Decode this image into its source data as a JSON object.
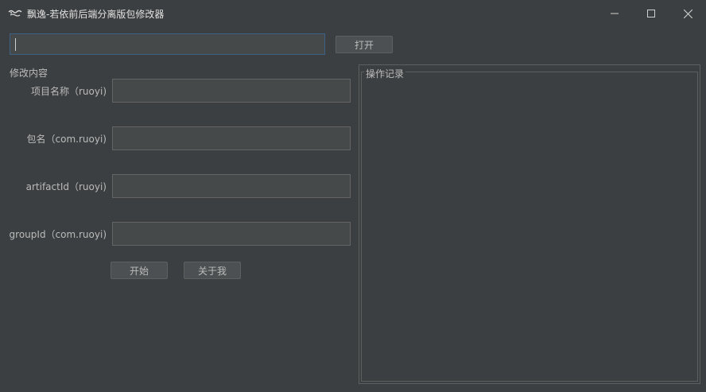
{
  "window": {
    "title": "飘逸-若依前后端分离版包修改器",
    "icon": "app-logo-icon",
    "controls": {
      "minimize": "minimize-icon",
      "maximize": "maximize-icon",
      "close": "close-icon"
    }
  },
  "path": {
    "value": "",
    "open_label": "打开"
  },
  "form": {
    "section_title": "修改内容",
    "fields": [
      {
        "label": "项目名称（ruoyi)",
        "value": ""
      },
      {
        "label": "包名（com.ruoyi)",
        "value": ""
      },
      {
        "label": "artifactId（ruoyi)",
        "value": ""
      },
      {
        "label": "groupId（com.ruoyi)",
        "value": ""
      }
    ],
    "start_label": "开始",
    "about_label": "关于我"
  },
  "log": {
    "title": "操作记录",
    "content": ""
  },
  "colors": {
    "background": "#3c3f41",
    "input_bg": "#45494a",
    "focus_border": "#3d6185",
    "text": "#bbbbbb"
  }
}
